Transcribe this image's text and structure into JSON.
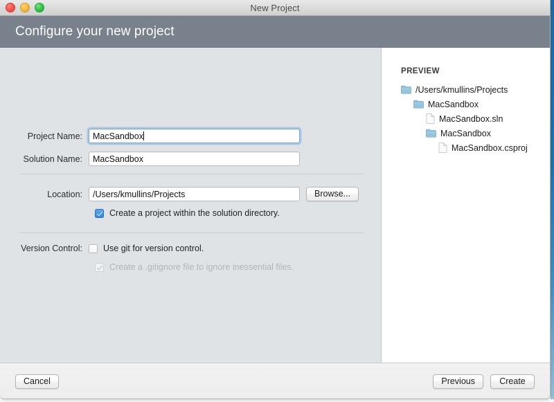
{
  "window": {
    "title": "New Project",
    "traffic_lights": [
      "close",
      "minimize",
      "maximize"
    ]
  },
  "header": {
    "title": "Configure your new project",
    "background_color": "#78818c"
  },
  "form": {
    "project_name": {
      "label": "Project Name:",
      "value": "MacSandbox",
      "focused": true
    },
    "solution_name": {
      "label": "Solution Name:",
      "value": "MacSandbox",
      "focused": false
    },
    "location": {
      "label": "Location:",
      "value": "/Users/kmullins/Projects",
      "browse_label": "Browse..."
    },
    "solution_dir_checkbox": {
      "label": "Create a project within the solution directory.",
      "checked": true,
      "enabled": true
    },
    "version_control": {
      "label": "Version Control:",
      "use_git": {
        "label": "Use git for version control.",
        "checked": false,
        "enabled": true
      },
      "gitignore": {
        "label": "Create a .gitignore file to ignore inessential files.",
        "checked": true,
        "enabled": false
      }
    }
  },
  "preview": {
    "heading": "PREVIEW",
    "tree": [
      {
        "label": "/Users/kmullins/Projects",
        "type": "folder",
        "depth": 0
      },
      {
        "label": "MacSandbox",
        "type": "folder",
        "depth": 1
      },
      {
        "label": "MacSandbox.sln",
        "type": "file",
        "depth": 2
      },
      {
        "label": "MacSandbox",
        "type": "folder",
        "depth": 2
      },
      {
        "label": "MacSandbox.csproj",
        "type": "file",
        "depth": 3
      }
    ]
  },
  "footer": {
    "cancel_label": "Cancel",
    "previous_label": "Previous",
    "create_label": "Create"
  },
  "colors": {
    "accent_checkbox": "#2f86e8",
    "header_bar": "#78818c",
    "form_background": "#e0e3e6",
    "preview_background": "#ffffff",
    "focus_ring": "#6ea5de"
  }
}
